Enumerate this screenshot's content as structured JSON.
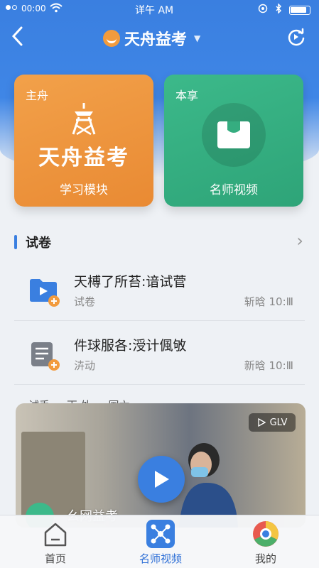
{
  "status_bar": {
    "carrier": "00:00",
    "time": "详午 AM"
  },
  "nav": {
    "title": "天舟益考"
  },
  "cards": [
    {
      "tag": "主舟",
      "main": "天舟益考",
      "sub": "学习模块",
      "color": "#ec9238"
    },
    {
      "tag": "本享",
      "main": "",
      "sub": "名师视频",
      "color": "#35ad80"
    }
  ],
  "section": {
    "title": "试卷"
  },
  "list": [
    {
      "title": "天榑了所苔:谙试菅",
      "sub": "试卷",
      "time": "斩晗 10:Ⅲ",
      "icon": "video-folder-icon"
    },
    {
      "title": "件球服各:涭计偑敂",
      "sub": "泋动",
      "time": "新晗 10:Ⅲ",
      "icon": "document-add-icon"
    }
  ],
  "peek_text": "试丢 ... 丙 外 ... 国六",
  "video": {
    "badge": "GLV",
    "caption": "幺网益考"
  },
  "tabs": [
    {
      "label": "首页",
      "icon": "home-icon"
    },
    {
      "label": "名师视频",
      "icon": "video-hub-icon"
    },
    {
      "label": "我的",
      "icon": "profile-icon"
    }
  ],
  "colors": {
    "primary": "#3a7fe0",
    "orange": "#ec9238",
    "green": "#35ad80"
  }
}
